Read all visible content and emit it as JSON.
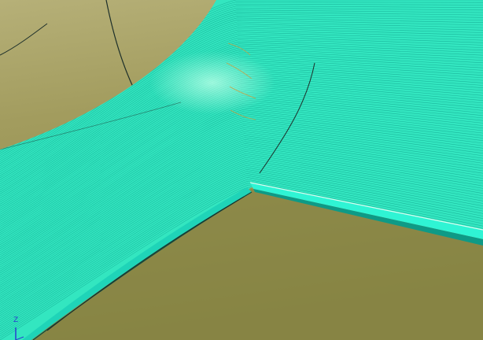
{
  "viewport": {
    "axis_triad": {
      "z_label": "Z"
    },
    "colors": {
      "background": "#8a8646",
      "background_upper": "#b3ad72",
      "toolpath_primary": "#33e6c0",
      "toolpath_bright": "#52ffd8",
      "toolpath_dark": "#0e9a86",
      "toolpath_orange": "#d49a35",
      "edge_line": "#1d2f2a",
      "axis_blue": "#2a3fd0"
    }
  }
}
